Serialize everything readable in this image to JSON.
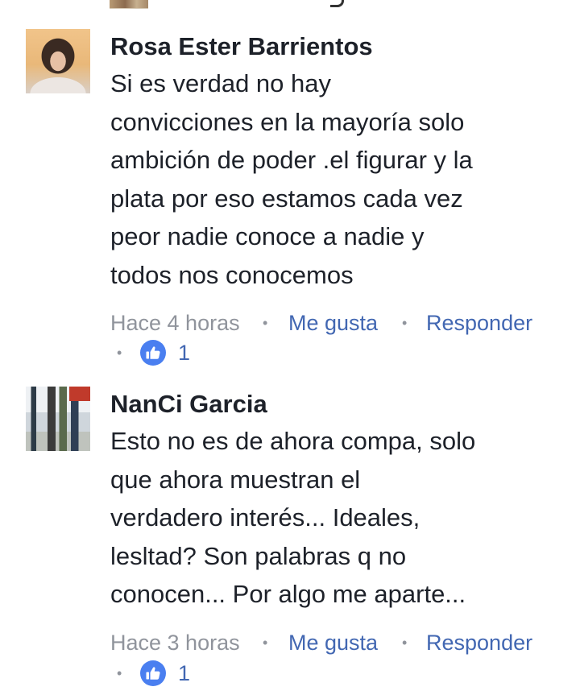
{
  "comments": [
    {
      "author": "Rosa Ester Barrientos",
      "text": "Si es verdad no hay\nconvicciones en la mayoría solo\nambición de poder .el figurar y la\nplata por eso estamos cada vez\npeor nadie conoce a nadie y\ntodos nos conocemos",
      "time": "Hace 4 horas",
      "like_label": "Me gusta",
      "reply_label": "Responder",
      "like_count": "1",
      "reaction_icon": "like-icon",
      "avatar_icon": "profile-photo"
    },
    {
      "author": "NanCi Garcia",
      "text": "Esto no es de ahora compa, solo\nque ahora muestran el\nverdadero interés... Ideales,\nlesltad? Son palabras q no\nconocen... Por algo me aparte...",
      "time": "Hace 3 horas",
      "like_label": "Me gusta",
      "reply_label": "Responder",
      "like_count": "1",
      "reaction_icon": "like-icon",
      "avatar_icon": "profile-photo"
    }
  ],
  "separator": "•",
  "colors": {
    "text": "#1d2129",
    "meta_gray": "#90949c",
    "link_blue": "#4267b2",
    "like_badge": "#4a7ff0"
  }
}
